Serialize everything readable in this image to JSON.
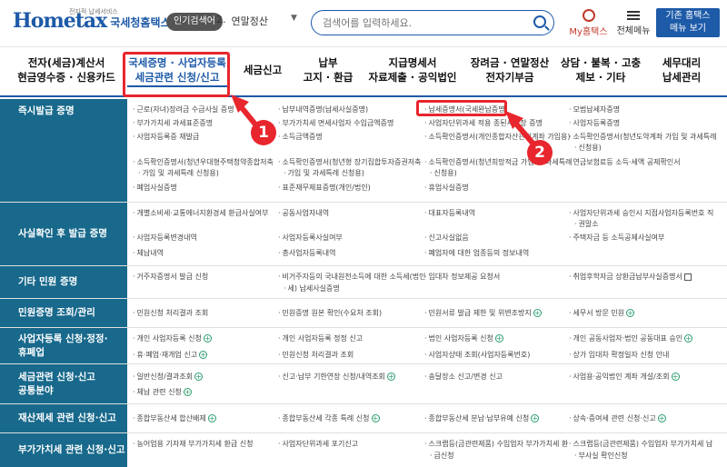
{
  "header": {
    "logo_small": "전자적 납세서비스",
    "logo_main": "Hometax",
    "logo_ko": "국세청홈택스",
    "popular_label": "인기검색어",
    "popular_rank": "2.",
    "popular_term": "연말정산",
    "search_placeholder": "검색어를 입력하세요.",
    "my_label": "My홈택스",
    "all_menu_label": "전체메뉴",
    "old_button_line1": "기존 홈택스",
    "old_button_line2": "메뉴 보기"
  },
  "gnb": [
    {
      "l1": "전자(세금)계산서",
      "l2": "현금영수증 · 신용카드"
    },
    {
      "l1": "국세증명 · 사업자등록",
      "l2": "세금관련 신청/신고"
    },
    {
      "l1": "세금신고",
      "l2": ""
    },
    {
      "l1": "납부",
      "l2": "고지 · 환급"
    },
    {
      "l1": "지급명세서",
      "l2": "자료제출 · 공익법인"
    },
    {
      "l1": "장려금 · 연말정산",
      "l2": "전자기부금"
    },
    {
      "l1": "상담 · 불복 · 고충",
      "l2": "제보 · 기타"
    },
    {
      "l1": "세무대리",
      "l2": "납세관리"
    }
  ],
  "badges": [
    "1",
    "2"
  ],
  "rows": [
    {
      "cat": "즉시발급 증명",
      "items": [
        "근로(자녀)장려금 수급사실 증명",
        "납부내역증명(납세사실증명)",
        "납세증명서(국세완납증명)",
        "모범납세자증명",
        "부가가치세 과세표준증명",
        "부가가치세 면세사업자 수입금액증명",
        "사업자단위과세 적용 종된사업장 증명",
        "사업자등록증명",
        "사업자등록증 재발급",
        "소득금액증명",
        "소득확인증명서(개인종합자산관리계좌 가입용)",
        "소득확인증명서(청년도약계좌 가입 및 과세특례",
        "신청용)",
        "소득확인증명서(청년우대형주택청약종합저축",
        "소득확인증명서(청년형 장기집합투자증권저축",
        "소득확인증명서(청년희망적금 가입 및 과세특례",
        "연금보험료등 소득·세액 공제확인서",
        "가입 및 과세특례 신청용)",
        "가입 및 과세특례 신청용)",
        "신청용)",
        "폐업사실증명",
        "표준재무제표증명(개인/법인)",
        "휴업사실증명"
      ]
    },
    {
      "cat": "사실확인 후 발급 증명",
      "items": [
        "개별소비세·교통에너지환경세 환급사실여부",
        "공동사업자내역",
        "대표자등록내역",
        "사업자단위과세 승인시 지점사업자등록번호 직",
        "권말소",
        "사업자등록변경내역",
        "사업자등록사실여부",
        "신고사실없음",
        "주택자금 등 소득공제사실여부",
        "체납내역",
        "총사업자등록내역",
        "폐업자에 대한 업종등의 정보내역"
      ]
    },
    {
      "cat": "기타 민원 증명",
      "items": [
        "거주자증명서 발급 신청",
        "비거주자등의 국내원천소득에 대한 소득세(법인",
        "임대차 정보제공 요청서",
        "취업후학자금 상환금납부사실증명서",
        "세) 납세사실증명"
      ]
    },
    {
      "cat": "민원증명 조회/관리",
      "items": [
        "민원신청 처리결과 조회",
        "민원증명 원본 확인(수요처 조회)",
        "민원서류 발급 제한 및 위변조방지",
        "세무서 방문 민원"
      ]
    },
    {
      "cat1": "사업자등록 신청·정정·",
      "cat2": "휴폐업",
      "items": [
        "개인 사업자등록 신청",
        "개인 사업자등록 정정 신고",
        "법인 사업자등록 신청",
        "개인 공동사업자·법인 공동대표 승인",
        "휴·폐업·재개업 신고",
        "민원신청 처리결과 조회",
        "사업자상태 조회(사업자등록번호)",
        "상가 임대차 확정일자 신청 안내"
      ]
    },
    {
      "cat1": "세금관련 신청·신고",
      "cat2": "공통분야",
      "items": [
        "일반신청/결과조회",
        "신고·납부 기한연장 신청/내역조회",
        "송달장소 신고/변경 신고",
        "사업용·공익법인 계좌 개설/조회",
        "체납 관련 신청"
      ]
    },
    {
      "cat": "재산제세 관련 신청·신고",
      "items": [
        "종합부동산세 합산배제",
        "종합부동산세 각종 특례 신청",
        "종합부동산세 분납·납부유예 신청",
        "상속·증여세 관련 신청·신고"
      ]
    },
    {
      "cat": "부가가치세 관련 신청·신고",
      "items": [
        "농어업용 기자재 부가가치세 환급 신청",
        "사업자단위과세 포기신고",
        "스크랩등(금관련제품) 수입업자 부가가치세 환",
        "스크랩등(금관련제품) 수입업자 부가가치세 납",
        "급신청",
        "부사실 확인신청"
      ]
    }
  ]
}
